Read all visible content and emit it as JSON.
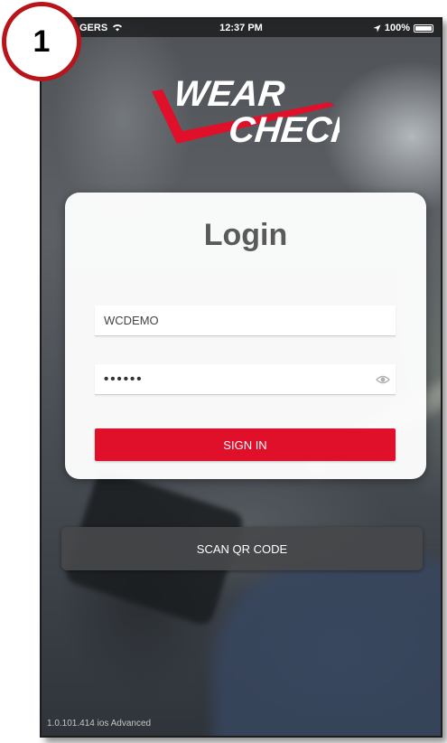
{
  "badge": {
    "number": "1"
  },
  "status_bar": {
    "carrier": "GERS",
    "time": "12:37 PM",
    "battery": "100%",
    "battery_level_percent": 100
  },
  "logo": {
    "line1": "WEAR",
    "line2": "CHECK",
    "brand_red": "#e0102a"
  },
  "login": {
    "title": "Login",
    "username_value": "WCDEMO",
    "password_value": "••••••",
    "sign_in_label": "SIGN IN"
  },
  "scan_label": "SCAN QR CODE",
  "version": "1.0.101.414 ios Advanced",
  "colors": {
    "accent": "#e0102a",
    "badge_ring": "#b8151b",
    "scan_button": "#464849",
    "title_gray": "#5a5a5a"
  },
  "icons": {
    "wifi": "wifi-icon",
    "location": "location-arrow-icon",
    "battery": "battery-icon",
    "eye": "eye-icon"
  }
}
